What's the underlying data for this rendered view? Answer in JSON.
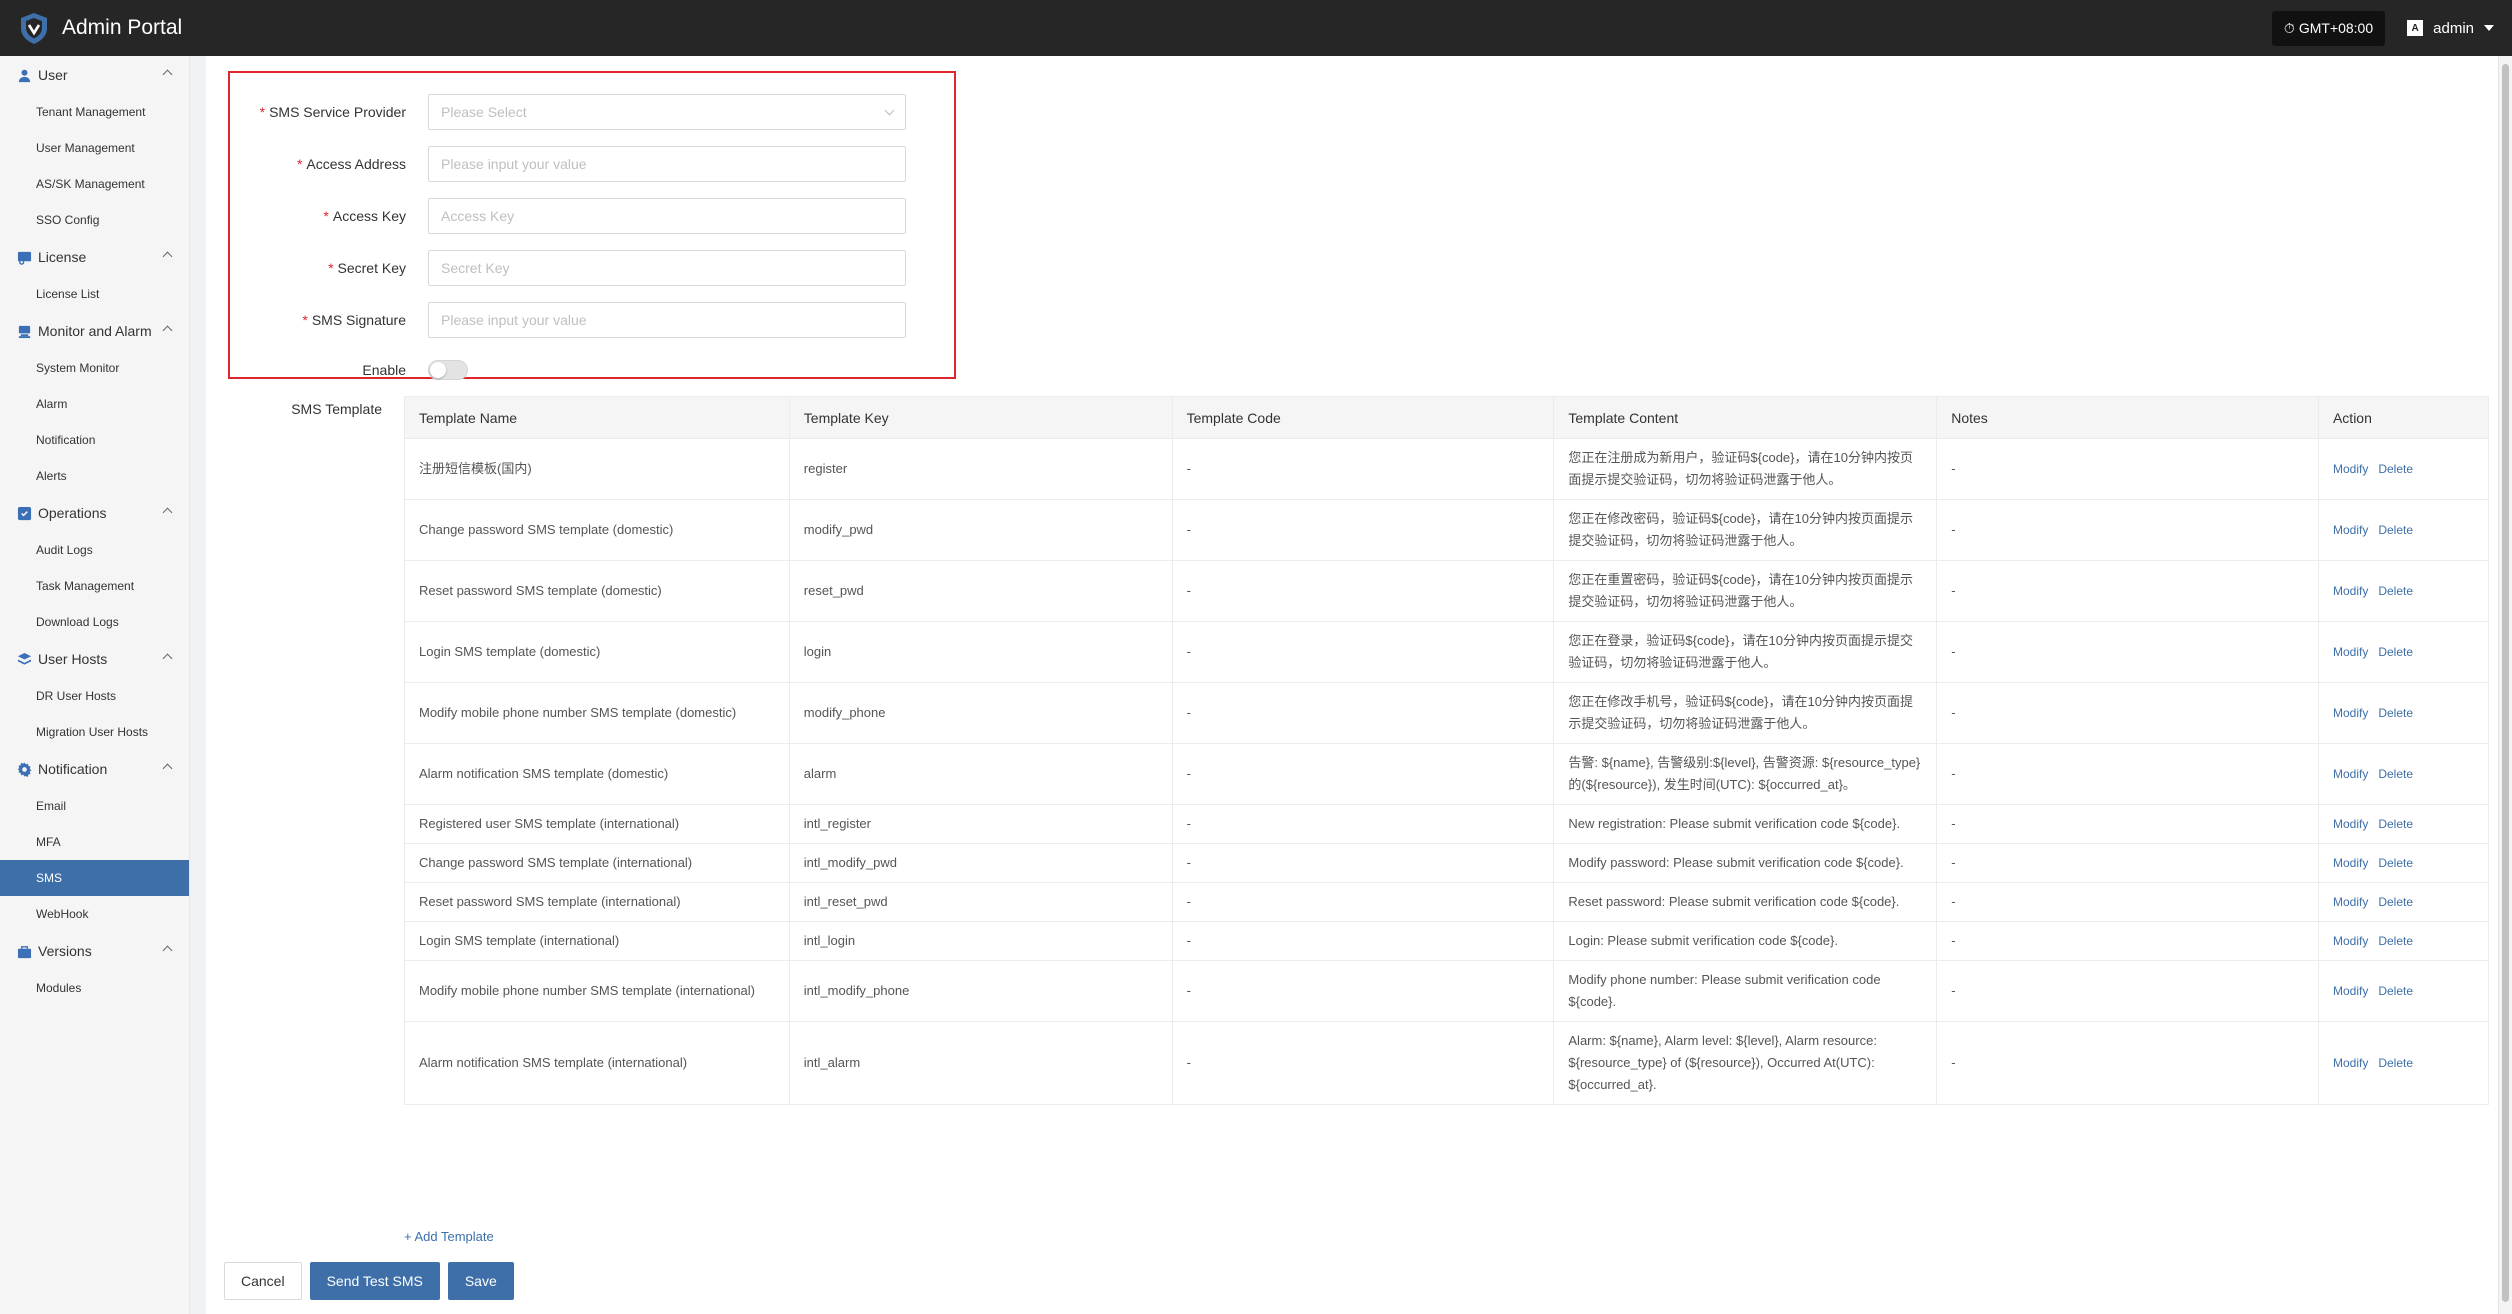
{
  "header": {
    "title": "Admin Portal",
    "timezone": "GMT+08:00",
    "user": "admin"
  },
  "sidebar": {
    "groups": [
      {
        "label": "User",
        "icon": "user-icon",
        "items": [
          "Tenant Management",
          "User Management",
          "AS/SK Management",
          "SSO Config"
        ]
      },
      {
        "label": "License",
        "icon": "license-icon",
        "items": [
          "License List"
        ]
      },
      {
        "label": "Monitor and Alarm",
        "icon": "monitor-icon",
        "items": [
          "System Monitor",
          "Alarm",
          "Notification",
          "Alerts"
        ]
      },
      {
        "label": "Operations",
        "icon": "operations-icon",
        "items": [
          "Audit Logs",
          "Task Management",
          "Download Logs"
        ]
      },
      {
        "label": "User Hosts",
        "icon": "hosts-icon",
        "items": [
          "DR User Hosts",
          "Migration User Hosts"
        ]
      },
      {
        "label": "Notification",
        "icon": "gear-icon",
        "items": [
          "Email",
          "MFA",
          "SMS",
          "WebHook"
        ]
      },
      {
        "label": "Versions",
        "icon": "versions-icon",
        "items": [
          "Modules"
        ]
      }
    ],
    "active_item": "SMS"
  },
  "form": {
    "provider": {
      "label": "SMS Service Provider",
      "placeholder": "Please Select"
    },
    "address": {
      "label": "Access Address",
      "placeholder": "Please input your value"
    },
    "access_key": {
      "label": "Access Key",
      "placeholder": "Access Key"
    },
    "secret_key": {
      "label": "Secret Key",
      "placeholder": "Secret Key"
    },
    "signature": {
      "label": "SMS Signature",
      "placeholder": "Please input your value"
    },
    "enable": {
      "label": "Enable",
      "on": false
    }
  },
  "template_section": {
    "label": "SMS Template",
    "columns": [
      "Template Name",
      "Template Key",
      "Template Code",
      "Template Content",
      "Notes",
      "Action"
    ],
    "rows": [
      {
        "name": "注册短信模板(国内)",
        "key": "register",
        "code": "-",
        "content": "您正在注册成为新用户，验证码${code}，请在10分钟内按页面提示提交验证码，切勿将验证码泄露于他人。",
        "notes": "-"
      },
      {
        "name": "Change password SMS template (domestic)",
        "key": "modify_pwd",
        "code": "-",
        "content": "您正在修改密码，验证码${code}，请在10分钟内按页面提示提交验证码，切勿将验证码泄露于他人。",
        "notes": "-"
      },
      {
        "name": "Reset password SMS template (domestic)",
        "key": "reset_pwd",
        "code": "-",
        "content": "您正在重置密码，验证码${code}，请在10分钟内按页面提示提交验证码，切勿将验证码泄露于他人。",
        "notes": "-"
      },
      {
        "name": "Login SMS template (domestic)",
        "key": "login",
        "code": "-",
        "content": "您正在登录，验证码${code}，请在10分钟内按页面提示提交验证码，切勿将验证码泄露于他人。",
        "notes": "-"
      },
      {
        "name": "Modify mobile phone number SMS template (domestic)",
        "key": "modify_phone",
        "code": "-",
        "content": "您正在修改手机号，验证码${code}，请在10分钟内按页面提示提交验证码，切勿将验证码泄露于他人。",
        "notes": "-"
      },
      {
        "name": "Alarm notification SMS template (domestic)",
        "key": "alarm",
        "code": "-",
        "content": "告警: ${name}, 告警级别:${level}, 告警资源: ${resource_type}的(${resource}), 发生时间(UTC): ${occurred_at}。",
        "notes": "-"
      },
      {
        "name": "Registered user SMS template (international)",
        "key": "intl_register",
        "code": "-",
        "content": "New registration: Please submit verification code ${code}.",
        "notes": "-"
      },
      {
        "name": "Change password SMS template (international)",
        "key": "intl_modify_pwd",
        "code": "-",
        "content": "Modify password: Please submit verification code ${code}.",
        "notes": "-"
      },
      {
        "name": "Reset password SMS template (international)",
        "key": "intl_reset_pwd",
        "code": "-",
        "content": "Reset password: Please submit verification code ${code}.",
        "notes": "-"
      },
      {
        "name": "Login SMS template (international)",
        "key": "intl_login",
        "code": "-",
        "content": "Login: Please submit verification code ${code}.",
        "notes": "-"
      },
      {
        "name": "Modify mobile phone number SMS template (international)",
        "key": "intl_modify_phone",
        "code": "-",
        "content": "Modify phone number: Please submit verification code ${code}.",
        "notes": "-"
      },
      {
        "name": "Alarm notification SMS template (international)",
        "key": "intl_alarm",
        "code": "-",
        "content": "Alarm: ${name}, Alarm level: ${level}, Alarm resource: ${resource_type} of (${resource}), Occurred At(UTC): ${occurred_at}.",
        "notes": "-"
      }
    ],
    "action_modify": "Modify",
    "action_delete": "Delete",
    "add_label": "+ Add Template"
  },
  "buttons": {
    "cancel": "Cancel",
    "test": "Send Test SMS",
    "save": "Save"
  },
  "colors": {
    "accent": "#3e6fa8",
    "header_bg": "#262626",
    "highlight_border": "#e0262d"
  }
}
